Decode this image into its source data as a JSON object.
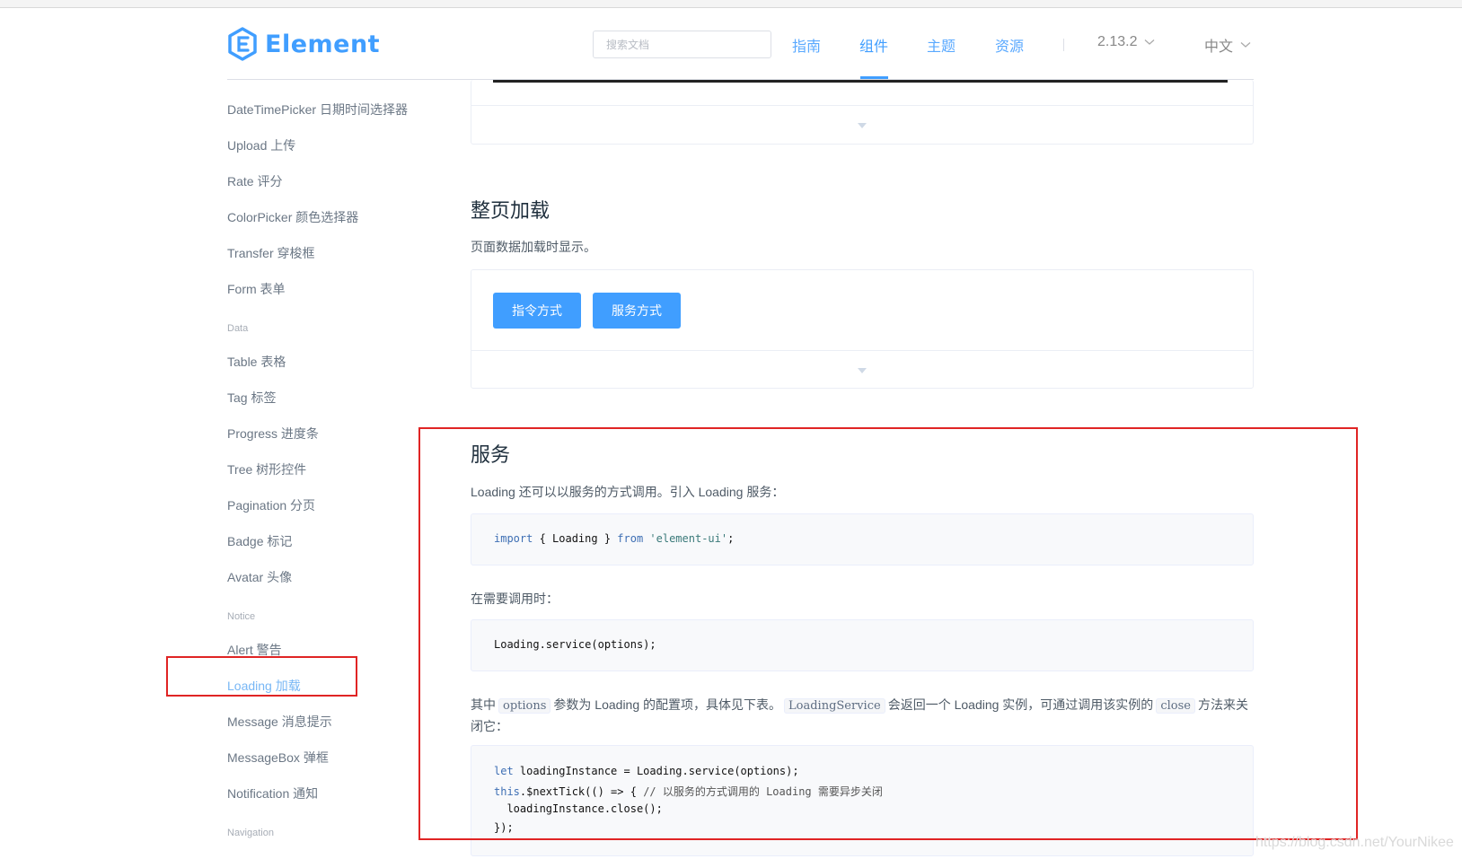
{
  "header": {
    "logo_text": "Element",
    "search_placeholder": "搜索文档",
    "nav": [
      {
        "label": "指南",
        "active": false
      },
      {
        "label": "组件",
        "active": true
      },
      {
        "label": "主题",
        "active": false
      },
      {
        "label": "资源",
        "active": false
      }
    ],
    "version": "2.13.2",
    "language": "中文",
    "accent_color": "#409eff"
  },
  "sidebar": {
    "items": [
      "DateTimePicker 日期时间选择器",
      "Upload 上传",
      "Rate 评分",
      "ColorPicker 颜色选择器",
      "Transfer 穿梭框",
      "Form 表单"
    ],
    "group_data": "Data",
    "data_items": [
      "Table 表格",
      "Tag 标签",
      "Progress 进度条",
      "Tree 树形控件",
      "Pagination 分页",
      "Badge 标记",
      "Avatar 头像"
    ],
    "group_notice": "Notice",
    "notice_items": [
      "Alert 警告",
      "Loading 加载",
      "Message 消息提示",
      "MessageBox 弹框",
      "Notification 通知"
    ],
    "group_navigation": "Navigation",
    "active_item": "Loading 加载"
  },
  "content": {
    "fullscreen_title": "整页加载",
    "fullscreen_desc": "页面数据加载时显示。",
    "button_directive": "指令方式",
    "button_service": "服务方式",
    "service_title": "服务",
    "service_desc": "Loading 还可以以服务的方式调用。引入 Loading 服务：",
    "code_import": {
      "kw1": "import",
      "mid": " { Loading } ",
      "kw2": "from",
      "str": " 'element-ui'",
      "end": ";"
    },
    "when_needed": "在需要调用时：",
    "code_call": "Loading.service(options);",
    "para_part1": "其中",
    "para_code1": "options",
    "para_part2": "参数为 Loading 的配置项，具体见下表。",
    "para_code2": "LoadingService",
    "para_part3": "会返回一个 Loading 实例，可通过调用该实例的",
    "para_code3": "close",
    "para_part4": "方法来关闭它：",
    "code_block": {
      "l1_kw": "let",
      "l1_rest": " loadingInstance = Loading.service(options);",
      "l2_kw": "this",
      "l2_rest": ".$nextTick(() => { ",
      "l2_cmt": "// 以服务的方式调用的 Loading 需要异步关闭",
      "l3": "  loadingInstance.close();",
      "l4": "});"
    }
  },
  "watermark": "https://blog.csdn.net/YourNikee"
}
